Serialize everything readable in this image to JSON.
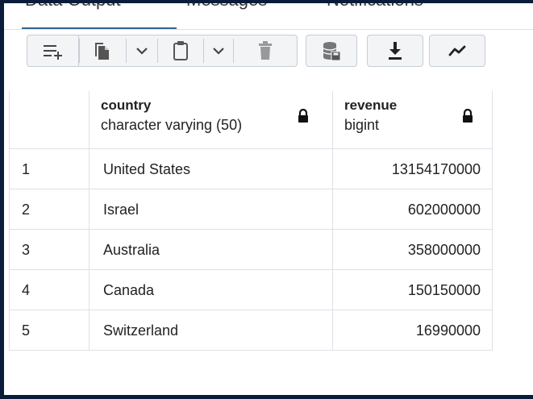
{
  "tabs": [
    {
      "label": "Data Output"
    },
    {
      "label": "Messages"
    },
    {
      "label": "Notifications"
    }
  ],
  "toolbar": {
    "buttons": [
      {
        "name": "add-row",
        "icon": "add-row-icon"
      },
      {
        "name": "copy",
        "icon": "copy-icon"
      },
      {
        "name": "copy-options",
        "icon": "chevron-down-icon"
      },
      {
        "name": "paste",
        "icon": "clipboard-icon"
      },
      {
        "name": "paste-options",
        "icon": "chevron-down-icon"
      },
      {
        "name": "delete",
        "icon": "trash-icon"
      },
      {
        "name": "save-data",
        "icon": "database-save-icon"
      },
      {
        "name": "download",
        "icon": "download-icon"
      },
      {
        "name": "graph",
        "icon": "line-graph-icon"
      }
    ]
  },
  "grid": {
    "columns": [
      {
        "name": "country",
        "type": "character varying (50)",
        "locked": true
      },
      {
        "name": "revenue",
        "type": "bigint",
        "locked": true
      }
    ],
    "rows": [
      {
        "index": "1",
        "country": "United States",
        "revenue": "13154170000"
      },
      {
        "index": "2",
        "country": "Israel",
        "revenue": "602000000"
      },
      {
        "index": "3",
        "country": "Australia",
        "revenue": "358000000"
      },
      {
        "index": "4",
        "country": "Canada",
        "revenue": "150150000"
      },
      {
        "index": "5",
        "country": "Switzerland",
        "revenue": "16990000"
      }
    ]
  },
  "colors": {
    "frame": "#0b1b3a",
    "active_tab_underline": "#326690",
    "toolbar_button_bg": "#f3f4f6",
    "grid_border": "#dde0e6"
  }
}
